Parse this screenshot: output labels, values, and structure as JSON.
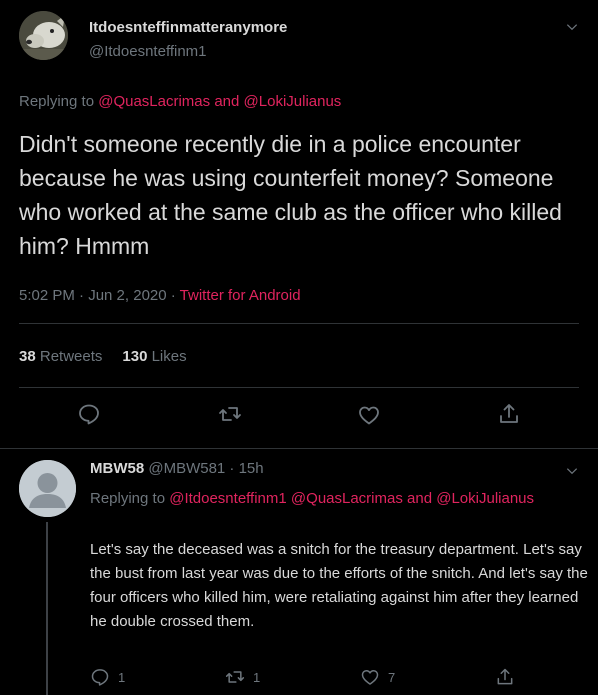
{
  "main_tweet": {
    "display_name": "Itdoesnteffinmatteranymore",
    "handle": "@Itdoesnteffinm1",
    "replying_prefix": "Replying to",
    "replying_user1": "@QuasLacrimas",
    "replying_and": "and",
    "replying_user2": "@LokiJulianus",
    "text": "Didn't someone recently die in a police encounter because he was using counterfeit money? Someone who worked at the same club as the officer who killed him? Hmmm",
    "time": "5:02 PM · Jun 2, 2020 ·",
    "source": "Twitter for Android",
    "retweets_count": "38",
    "retweets_label": "Retweets",
    "likes_count": "130",
    "likes_label": "Likes"
  },
  "reply": {
    "display_name": "MBW58",
    "handle_time": "@MBW581 · 15h",
    "replying_prefix": "Replying to",
    "replying_user1": "@Itdoesnteffinm1",
    "replying_user2": "@QuasLacrimas",
    "replying_and": "and",
    "replying_user3": "@LokiJulianus",
    "text": "Let's say the deceased was a snitch for the treasury department. Let's say the bust from last year was due to the efforts of the snitch. And let's say the four officers who killed him, were retaliating against him after they learned he double crossed them.",
    "reply_count": "1",
    "retweet_count": "1",
    "like_count": "7"
  },
  "colors": {
    "background": "#000000",
    "text": "#d9d9d9",
    "muted": "#6e767d",
    "link": "#e0245e",
    "divider": "#2f3336"
  },
  "icons": [
    "reply-icon",
    "retweet-icon",
    "like-icon",
    "share-icon",
    "chevron-down-icon",
    "default-avatar-icon"
  ]
}
